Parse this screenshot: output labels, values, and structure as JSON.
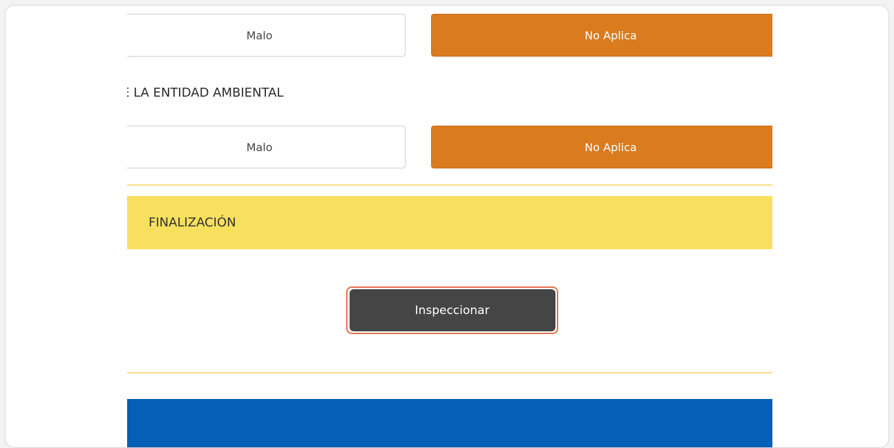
{
  "colors": {
    "accent_orange": "#DB7B1F",
    "section_yellow": "#F7E05D",
    "divider_yellow": "#F6DF88",
    "button_dark": "#454545",
    "button_ring": "#E8704A",
    "footer_blue": "#065FB6"
  },
  "row1": {
    "malo_label": "Malo",
    "noaplica_label": "No Aplica",
    "noaplica_selected": true
  },
  "section_label": "E LA ENTIDAD AMBIENTAL",
  "row2": {
    "malo_label": "Malo",
    "noaplica_label": "No Aplica",
    "noaplica_selected": true
  },
  "finalizacion": {
    "title": "FINALIZACIÓN"
  },
  "inspect_button": {
    "label": "Inspeccionar"
  }
}
